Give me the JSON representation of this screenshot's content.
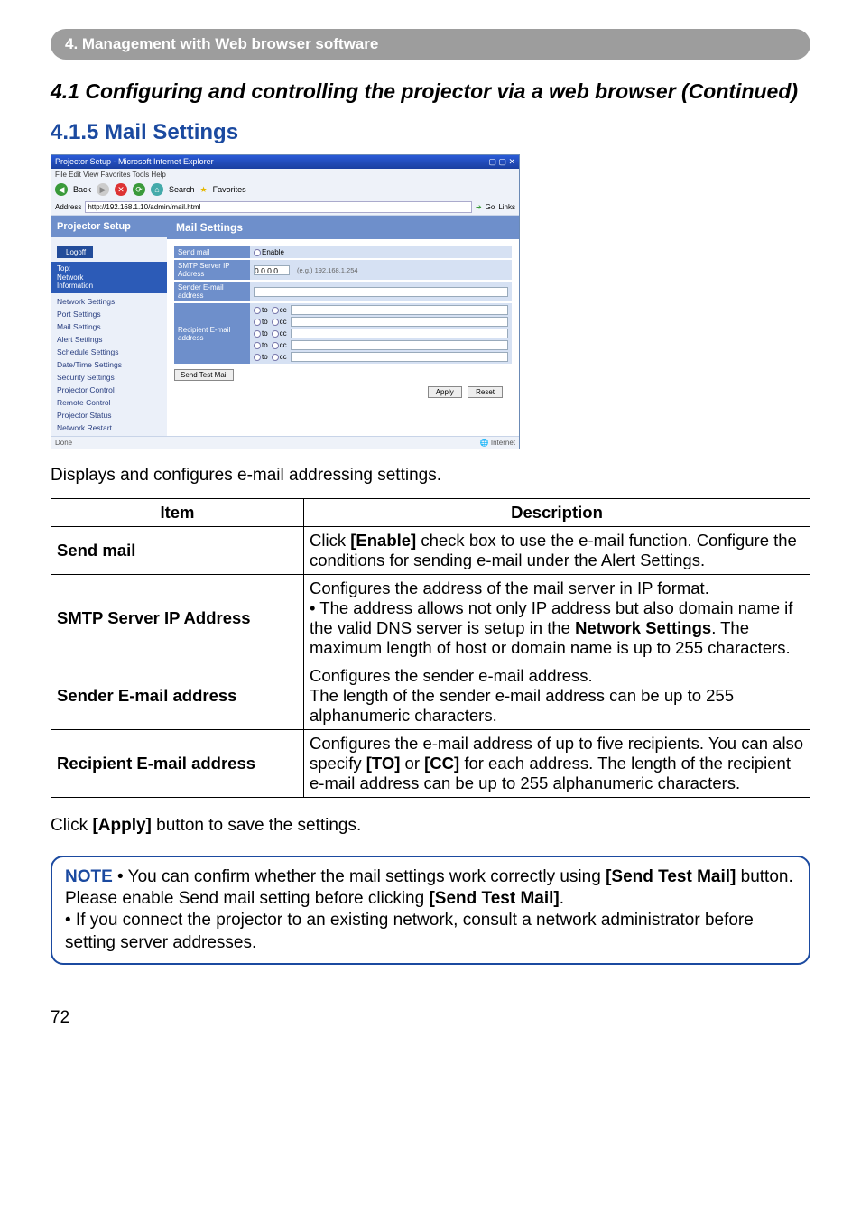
{
  "banner": "4. Management with Web browser software",
  "h2": "4.1 Configuring and controlling the projector via a web browser (Continued)",
  "h3": "4.1.5 Mail Settings",
  "screenshot": {
    "window_title": "Projector Setup - Microsoft Internet Explorer",
    "menu": "File   Edit   View   Favorites   Tools   Help",
    "toolbar_back": "Back",
    "toolbar_search": "Search",
    "toolbar_fav": "Favorites",
    "addr_label": "Address",
    "addr_value": "http://192.168.1.10/admin/mail.html",
    "addr_go": "Go",
    "addr_links": "Links",
    "side_head": "Projector Setup",
    "logoff": "Logoff",
    "topinfo_l1": "Top:",
    "topinfo_l2": "Network",
    "topinfo_l3": "Information",
    "side_links": [
      "Network Settings",
      "Port Settings",
      "Mail Settings",
      "Alert Settings",
      "Schedule Settings",
      "Date/Time Settings",
      "Security Settings",
      "Projector Control",
      "Remote Control",
      "Projector Status",
      "Network Restart"
    ],
    "main_title": "Mail Settings",
    "lbl_sendmail": "Send mail",
    "chk_enable": "Enable",
    "lbl_smtp": "SMTP Server IP Address",
    "smtp_default": "0.0.0.0",
    "smtp_eg": "(e.g.) 192.168.1.254",
    "lbl_sender": "Sender E-mail address",
    "lbl_recipient": "Recipient E-mail address",
    "to": "to",
    "cc": "cc",
    "btn_sendtest": "Send Test Mail",
    "btn_apply": "Apply",
    "btn_reset": "Reset",
    "status_done": "Done",
    "status_net": "Internet"
  },
  "intro": "Displays and configures e-mail addressing settings.",
  "table": {
    "col_item": "Item",
    "col_desc": "Description",
    "rows": [
      {
        "item": "Send mail",
        "desc_pre": "Click ",
        "desc_bold1": "[Enable]",
        "desc_post": " check box to use the e-mail function. Configure the conditions for sending e-mail under the Alert Settings."
      },
      {
        "item": "SMTP Server IP Address",
        "desc_pre": "Configures the address of the mail server in IP format.\n• The address allows not only IP address but also domain name if the valid DNS server is setup in the ",
        "desc_bold1": "Network Settings",
        "desc_post": ". The maximum length of host or domain name is up to 255 characters."
      },
      {
        "item": "Sender E-mail address",
        "desc_plain": "Configures the sender e-mail address.\nThe length of the sender e-mail address can be up to 255 alphanumeric characters."
      },
      {
        "item": "Recipient E-mail address",
        "desc_pre": "Configures the e-mail address of up to five recipients. You can also specify ",
        "desc_bold1": "[TO]",
        "desc_mid": " or ",
        "desc_bold2": "[CC]",
        "desc_post": " for each address. The length of the recipient e-mail address can be up to 255 alphanumeric characters."
      }
    ]
  },
  "apply_line_pre": "Click ",
  "apply_line_bold": "[Apply]",
  "apply_line_post": " button to save the settings.",
  "note": {
    "label": "NOTE",
    "p1_pre": "  • You can confirm whether the mail settings work correctly using ",
    "p1_b1": "[Send Test Mail]",
    "p1_mid": " button. Please enable Send mail setting before clicking ",
    "p1_b2": "[Send Test Mail]",
    "p1_post": ".",
    "p2": "• If you connect the projector to an existing network, consult a network administrator before setting server addresses."
  },
  "pagenum": "72"
}
